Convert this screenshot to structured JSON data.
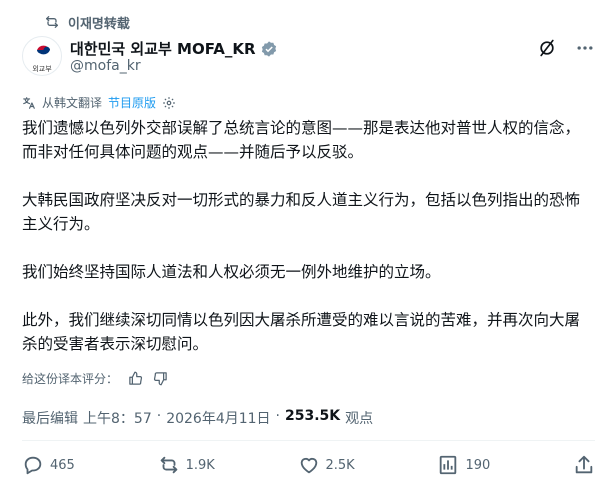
{
  "repost": {
    "label": "이재명转载"
  },
  "author": {
    "display_name": "대한민국 외교부 MOFA_KR",
    "handle": "@mofa_kr",
    "logo_text": "외교부"
  },
  "translation": {
    "source_label": "从韩文翻译",
    "show_original": "节目原版"
  },
  "post": {
    "paragraphs": [
      "我们遗憾以色列外交部误解了总统言论的意图——那是表达他对普世人权的信念，而非对任何具体问题的观点——并随后予以反驳。",
      "大韩民国政府坚决反对一切形式的暴力和反人道主义行为，包括以色列指出的恐怖主义行为。",
      "我们始终坚持国际人道法和人权必须无一例外地维护的立场。",
      "此外，我们继续深切同情以色列因大屠杀所遭受的难以言说的苦难，并再次向大屠杀的受害者表示深切慰问。"
    ]
  },
  "rating": {
    "prompt": "给这份译本评分："
  },
  "meta": {
    "edited": "最后编辑",
    "time": "上午8：57",
    "separator": "·",
    "date": "2026年4月11日",
    "views_count": "253.5K",
    "views_label": "观点"
  },
  "actions": {
    "replies": "465",
    "reposts": "1.9K",
    "likes": "2.5K",
    "bookmarks": "190"
  },
  "colors": {
    "accent": "#1d9bf0",
    "muted": "#536471",
    "text": "#0f1419"
  }
}
